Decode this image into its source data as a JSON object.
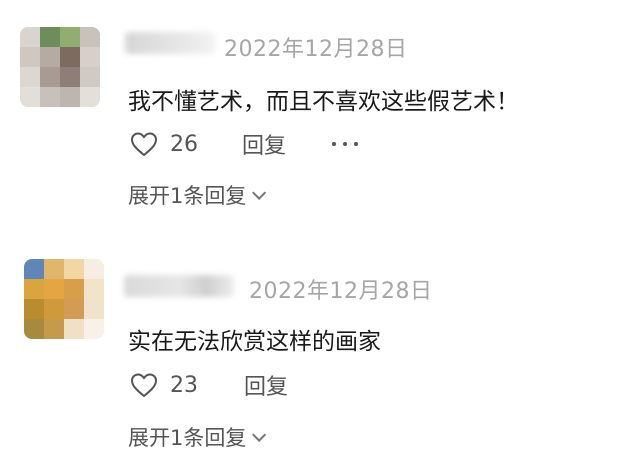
{
  "comments": [
    {
      "timestamp": "2022年12月28日",
      "text": "我不懂艺术，而且不喜欢这些假艺术！",
      "likes": "26",
      "reply_label": "回复",
      "expand_label": "展开1条回复",
      "avatar_colors": [
        "#d9d4cf",
        "#6f8d5a",
        "#8fae6f",
        "#c9c2bb",
        "#cfc7c0",
        "#b6aba3",
        "#7d6b60",
        "#d6d0ca",
        "#dcd7d2",
        "#a79b93",
        "#8d7f77",
        "#cfcac4",
        "#e2deda",
        "#c8c1bb",
        "#bdb5ae",
        "#e3e0dc"
      ]
    },
    {
      "timestamp": "2022年12月28日",
      "text": "实在无法欣赏这样的画家",
      "likes": "23",
      "reply_label": "回复",
      "expand_label": "展开1条回复",
      "avatar_colors": [
        "#5f86b8",
        "#e0b76a",
        "#f1d7a3",
        "#f6eee3",
        "#d9a53c",
        "#e3a640",
        "#d79f4a",
        "#f3e3c8",
        "#b98d2e",
        "#cf9a3a",
        "#d39b54",
        "#f1e2cb",
        "#a88a3e",
        "#c59a4a",
        "#f0e0c6",
        "#f7f1e8"
      ]
    }
  ],
  "colors": {
    "text": "#1a1a1a",
    "secondary": "#555555",
    "timestamp": "#a6a6a6"
  },
  "icons": [
    "heart-icon",
    "more-icon",
    "chevron-down-icon"
  ]
}
